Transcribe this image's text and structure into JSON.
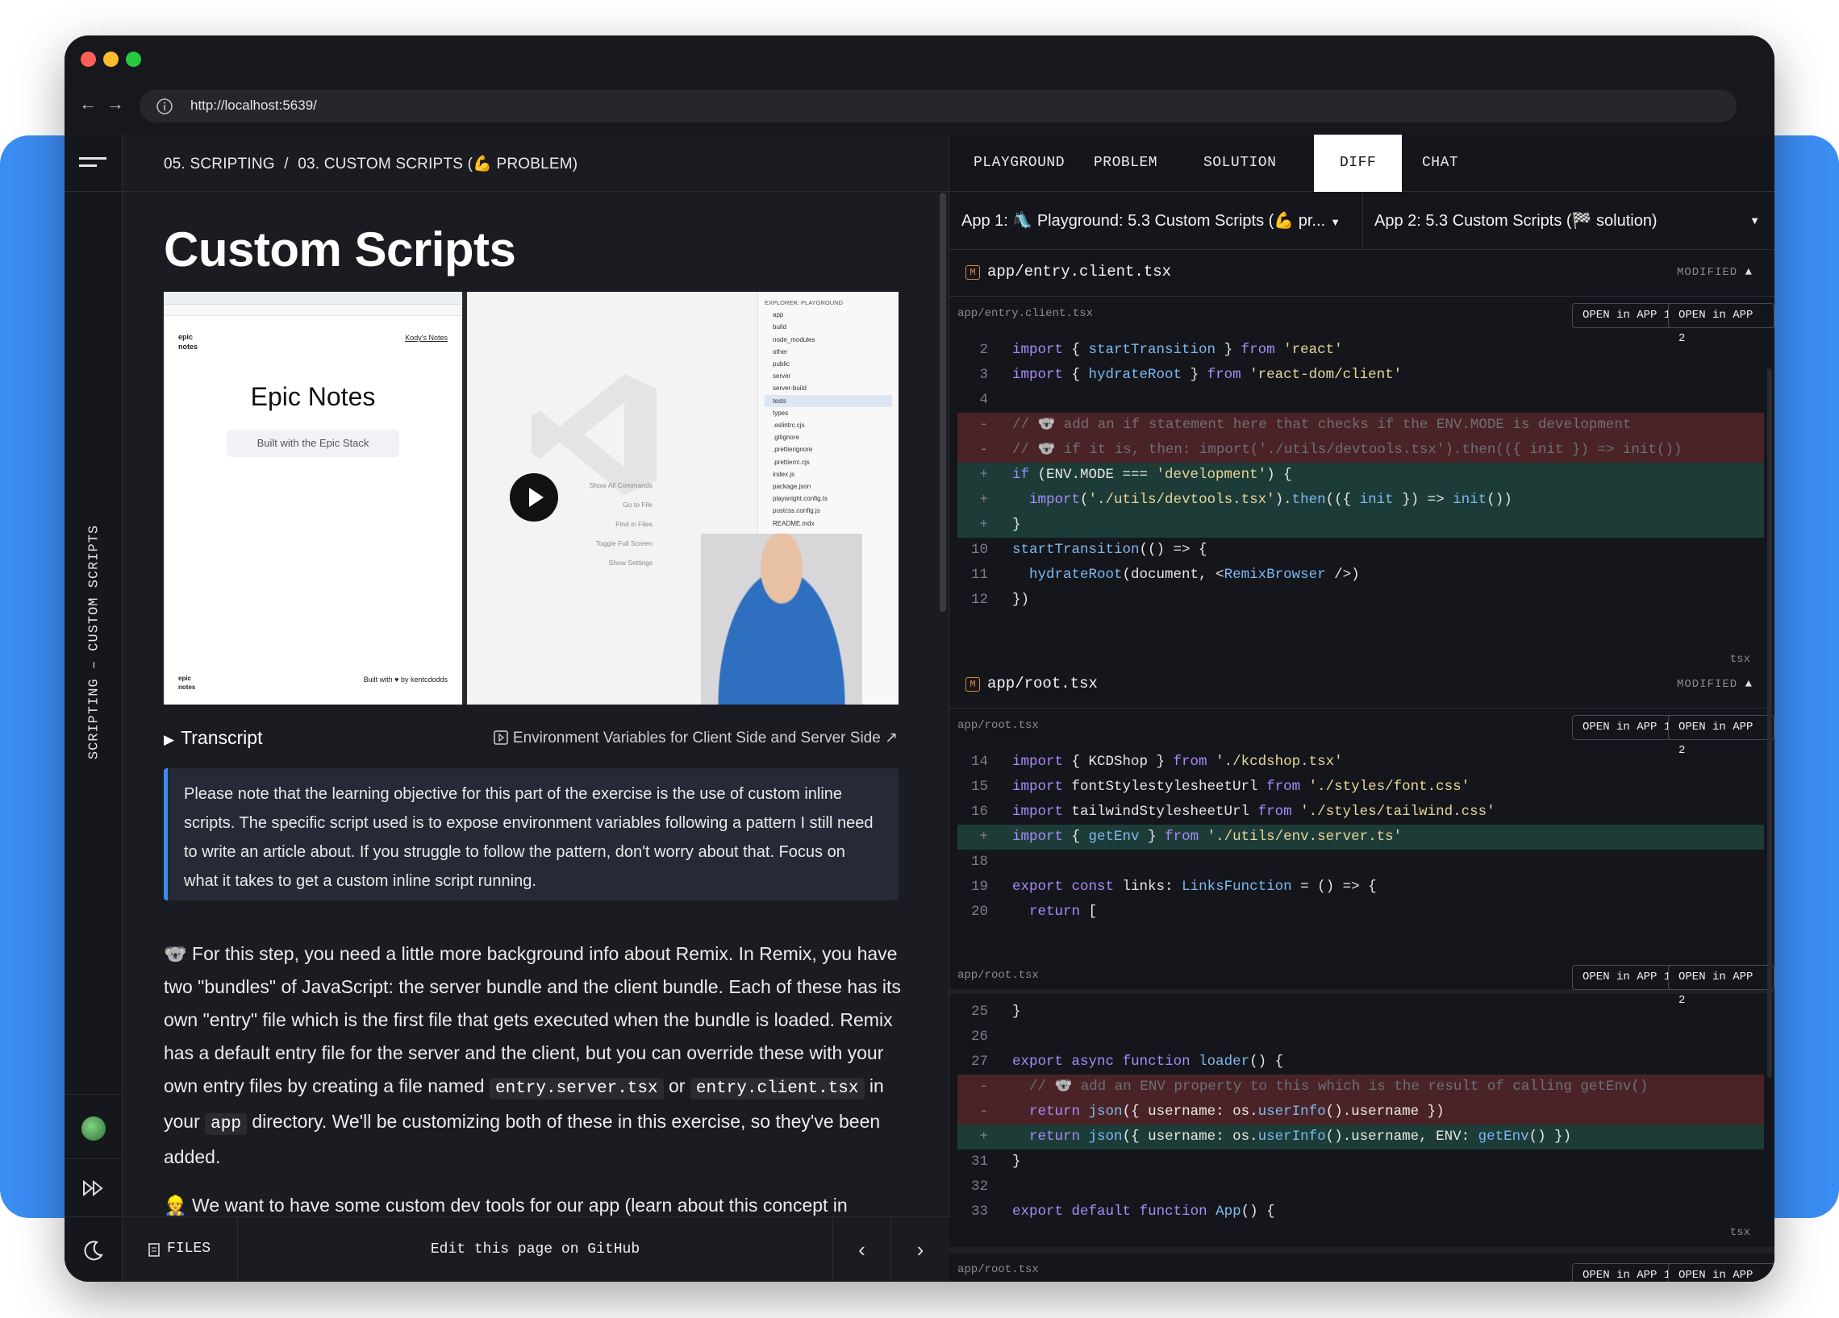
{
  "browser": {
    "url": "http://localhost:5639/",
    "colors": {
      "red": "#ff5f57",
      "yellow": "#febc2e",
      "green": "#28c840"
    }
  },
  "sidebar": {
    "vertical_title": "SCRIPTING – CUSTOM SCRIPTS"
  },
  "breadcrumb": {
    "part1": "05. SCRIPTING",
    "sep": "/",
    "part2": "03. CUSTOM SCRIPTS (💪 PROBLEM)"
  },
  "page": {
    "title": "Custom Scripts",
    "transcript_label": "Transcript",
    "env_link": "Environment Variables for Client Side and Server Side ↗",
    "callout": "Please note that the learning objective for this part of the exercise is the use of custom inline scripts. The specific script used is to expose environment variables following a pattern I still need to write an article about. If you struggle to follow the pattern, don't worry about that. Focus on what it takes to get a custom inline script running.",
    "p1_a": "🐨 For this step, you need a little more background info about Remix. In Remix, you have two \"bundles\" of JavaScript: the server bundle and the client bundle. Each of these has its own \"entry\" file which is the first file that gets executed when the bundle is loaded. Remix has a default entry file for the server and the client, but you can override these with your own entry files by creating a file named ",
    "p1_code1": "entry.server.tsx",
    "p1_b": " or ",
    "p1_code2": "entry.client.tsx",
    "p1_c": " in your ",
    "p1_code3": "app",
    "p1_d": " directory. We'll be customizing both of these in this exercise, so they've been added.",
    "p2": "👷 We want to have some custom dev tools for our app (learn about this concept in"
  },
  "video": {
    "left_brand": "epic\nnotes",
    "left_link": "Kody's Notes",
    "left_title": "Epic Notes",
    "left_badge": "Built with the Epic Stack",
    "left_footer": "Built with ♥ by kentcdodds",
    "explorer_title": "EXPLORER: PLAYGROUND",
    "explorer_items": [
      "app",
      "build",
      "node_modules",
      "other",
      "public",
      "server",
      "server-build",
      "tests",
      "types",
      ".eslintrc.cjs",
      ".gitignore",
      ".prettierignore",
      ".prettierrc.cjs",
      "index.js",
      "package.json",
      "playwright.config.ts",
      "postcss.config.js",
      "README.mdx"
    ],
    "commands": [
      "Show All Commands",
      "Go to File",
      "Find in Files",
      "Toggle Full Screen",
      "Show Settings"
    ]
  },
  "footer": {
    "files": "FILES",
    "edit": "Edit this page on GitHub"
  },
  "tabs": [
    "PLAYGROUND",
    "PROBLEM",
    "SOLUTION",
    "DIFF",
    "CHAT"
  ],
  "selectors": {
    "app1": "App 1: 🛝 Playground: 5.3 Custom Scripts (💪 pr...",
    "app2": "App 2: 5.3 Custom Scripts (🏁 solution)"
  },
  "diff": {
    "modified": "MODIFIED",
    "open1": "OPEN in APP 1",
    "open2": "OPEN in APP 2",
    "lang": "tsx",
    "file1": {
      "name": "app/entry.client.tsx",
      "lines": [
        {
          "n": "2",
          "t": "import { startTransition } from 'react'"
        },
        {
          "n": "3",
          "t": "import { hydrateRoot } from 'react-dom/client'"
        },
        {
          "n": "4",
          "t": ""
        },
        {
          "n": "-",
          "t": "// 🐨 add an if statement here that checks if the ENV.MODE is development"
        },
        {
          "n": "-",
          "t": "// 🐨 if it is, then: import('./utils/devtools.tsx').then(({ init }) => init())"
        },
        {
          "n": "+",
          "t": "if (ENV.MODE === 'development') {"
        },
        {
          "n": "+",
          "t": "  import('./utils/devtools.tsx').then(({ init }) => init())"
        },
        {
          "n": "+",
          "t": "}"
        },
        {
          "n": "10",
          "t": "startTransition(() => {"
        },
        {
          "n": "11",
          "t": "  hydrateRoot(document, <RemixBrowser />)"
        },
        {
          "n": "12",
          "t": "})"
        }
      ]
    },
    "file2": {
      "name": "app/root.tsx",
      "hunk1": [
        {
          "n": "14",
          "t": "import { KCDShop } from './kcdshop.tsx'"
        },
        {
          "n": "15",
          "t": "import fontStylestylesheetUrl from './styles/font.css'"
        },
        {
          "n": "16",
          "t": "import tailwindStylesheetUrl from './styles/tailwind.css'"
        },
        {
          "n": "+",
          "t": "import { getEnv } from './utils/env.server.ts'"
        },
        {
          "n": "18",
          "t": ""
        },
        {
          "n": "19",
          "t": "export const links: LinksFunction = () => {"
        },
        {
          "n": "20",
          "t": "  return ["
        }
      ],
      "hunk2": [
        {
          "n": "25",
          "t": "}"
        },
        {
          "n": "26",
          "t": ""
        },
        {
          "n": "27",
          "t": "export async function loader() {"
        },
        {
          "n": "-",
          "t": "  // 🐨 add an ENV property to this which is the result of calling getEnv()"
        },
        {
          "n": "-",
          "t": "  return json({ username: os.userInfo().username })"
        },
        {
          "n": "+",
          "t": "  return json({ username: os.userInfo().username, ENV: getEnv() })"
        },
        {
          "n": "31",
          "t": "}"
        },
        {
          "n": "32",
          "t": ""
        },
        {
          "n": "33",
          "t": "export default function App() {"
        }
      ]
    }
  }
}
